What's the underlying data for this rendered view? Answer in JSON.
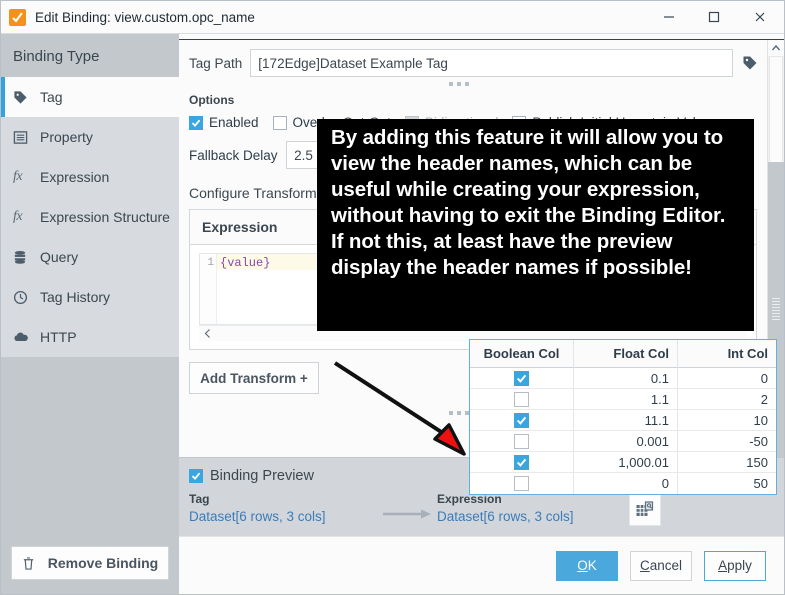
{
  "window": {
    "title": "Edit Binding: view.custom.opc_name",
    "app_icon": "ignition-check-icon",
    "minimize": "minimize-icon",
    "maximize": "maximize-icon",
    "close": "close-icon"
  },
  "sidebar": {
    "heading": "Binding Type",
    "items": [
      {
        "label": "Tag",
        "icon": "tag-icon",
        "active": true
      },
      {
        "label": "Property",
        "icon": "property-list-icon",
        "active": false
      },
      {
        "label": "Expression",
        "icon": "fx-icon",
        "active": false
      },
      {
        "label": "Expression Structure",
        "icon": "fx-icon",
        "active": false
      },
      {
        "label": "Query",
        "icon": "database-icon",
        "active": false
      },
      {
        "label": "Tag History",
        "icon": "clock-icon",
        "active": false
      },
      {
        "label": "HTTP",
        "icon": "cloud-icon",
        "active": false
      }
    ],
    "remove_binding": "Remove Binding",
    "remove_binding_icon": "trash-icon"
  },
  "tag_path": {
    "label": "Tag Path",
    "value": "[172Edge]Dataset Example Tag",
    "placeholder": "Tag path",
    "browse_icon": "tag-icon"
  },
  "options": {
    "heading": "Options",
    "checkboxes": [
      {
        "label": "Enabled",
        "checked": true,
        "disabled": false
      },
      {
        "label": "Overlay Opt-Out",
        "checked": false,
        "disabled": false
      },
      {
        "label": "Bidirectional",
        "checked": false,
        "disabled": true
      },
      {
        "label": "Publish Initial Uncertain Value",
        "checked": false,
        "disabled": false
      }
    ],
    "fallback_delay_label": "Fallback Delay",
    "fallback_delay_value": "2.5"
  },
  "transform": {
    "heading": "Configure Transform",
    "card_title": "Expression",
    "code_line_number": "1",
    "code_text": "{value}",
    "add_transform": "Add Transform +"
  },
  "preview": {
    "checkbox_label": "Binding Preview",
    "checked": true,
    "tag_caption": "Tag",
    "tag_value": "Dataset[6 rows, 3 cols]",
    "expression_caption": "Expression",
    "expression_value": "Dataset[6 rows, 3 cols]",
    "dataset_viewer_icon": "dataset-table-icon"
  },
  "footer": {
    "ok": "OK",
    "ok_mnemonic": "O",
    "cancel": "Cancel",
    "cancel_mnemonic": "C",
    "apply": "Apply",
    "apply_mnemonic": "A"
  },
  "data_table": {
    "headers": [
      "Boolean Col",
      "Float Col",
      "Int Col"
    ],
    "rows": [
      {
        "boolean": true,
        "float": "0.1",
        "int": "0"
      },
      {
        "boolean": false,
        "float": "1.1",
        "int": "2"
      },
      {
        "boolean": true,
        "float": "11.1",
        "int": "10"
      },
      {
        "boolean": false,
        "float": "0.001",
        "int": "-50"
      },
      {
        "boolean": true,
        "float": "1,000.01",
        "int": "150"
      },
      {
        "boolean": false,
        "float": "0",
        "int": "50"
      }
    ]
  },
  "annotation": {
    "text": "By adding this feature it will allow you to view the header names, which can be useful while creating your expression, without having to exit the Binding Editor.\nIf not this, at least have the preview display the header names if possible!",
    "background": "#000000",
    "color": "#ffffff",
    "arrow_color": "#ee1111"
  },
  "colors": {
    "accent": "#4aa8dd",
    "checkbox_on": "#3aa6e0",
    "link": "#3a7cb8",
    "sidebar_bg": "#c3c8cc",
    "nav_bg": "#d7dade",
    "title_icon": "#f2921d"
  }
}
